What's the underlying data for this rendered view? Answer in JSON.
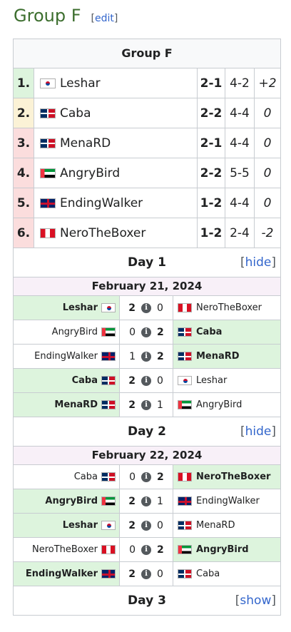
{
  "heading": {
    "title": "Group F",
    "edit_label": "edit"
  },
  "group_title": "Group F",
  "standings": [
    {
      "rank": "1.",
      "rank_color": "#ddf4dd",
      "flag": "kr",
      "name": "Leshar",
      "match_score": "2-1",
      "game_score": "4-2",
      "diff": "+2"
    },
    {
      "rank": "2.",
      "rank_color": "#fbf2d6",
      "flag": "do",
      "name": "Caba",
      "match_score": "2-2",
      "game_score": "4-4",
      "diff": "0"
    },
    {
      "rank": "3.",
      "rank_color": "#fbdddd",
      "flag": "do",
      "name": "MenaRD",
      "match_score": "2-1",
      "game_score": "4-4",
      "diff": "0"
    },
    {
      "rank": "4.",
      "rank_color": "#fbdddd",
      "flag": "ae",
      "name": "AngryBird",
      "match_score": "2-2",
      "game_score": "5-5",
      "diff": "0"
    },
    {
      "rank": "5.",
      "rank_color": "#fbdddd",
      "flag": "gb",
      "name": "EndingWalker",
      "match_score": "1-2",
      "game_score": "4-4",
      "diff": "0"
    },
    {
      "rank": "6.",
      "rank_color": "#fbdddd",
      "flag": "pe",
      "name": "NeroTheBoxer",
      "match_score": "1-2",
      "game_score": "2-4",
      "diff": "-2"
    }
  ],
  "days": [
    {
      "title": "Day 1",
      "toggle_label": "hide",
      "date": "February 21, 2024",
      "matches": [
        {
          "p1": "Leshar",
          "f1": "kr",
          "s1": "2",
          "s2": "0",
          "p2": "NeroTheBoxer",
          "f2": "pe",
          "winner": 1
        },
        {
          "p1": "AngryBird",
          "f1": "ae",
          "s1": "0",
          "s2": "2",
          "p2": "Caba",
          "f2": "do",
          "winner": 2
        },
        {
          "p1": "EndingWalker",
          "f1": "gb",
          "s1": "1",
          "s2": "2",
          "p2": "MenaRD",
          "f2": "do",
          "winner": 2
        },
        {
          "p1": "Caba",
          "f1": "do",
          "s1": "2",
          "s2": "0",
          "p2": "Leshar",
          "f2": "kr",
          "winner": 1
        },
        {
          "p1": "MenaRD",
          "f1": "do",
          "s1": "2",
          "s2": "1",
          "p2": "AngryBird",
          "f2": "ae",
          "winner": 1
        }
      ]
    },
    {
      "title": "Day 2",
      "toggle_label": "hide",
      "date": "February 22, 2024",
      "matches": [
        {
          "p1": "Caba",
          "f1": "do",
          "s1": "0",
          "s2": "2",
          "p2": "NeroTheBoxer",
          "f2": "pe",
          "winner": 2
        },
        {
          "p1": "AngryBird",
          "f1": "ae",
          "s1": "2",
          "s2": "1",
          "p2": "EndingWalker",
          "f2": "gb",
          "winner": 1
        },
        {
          "p1": "Leshar",
          "f1": "kr",
          "s1": "2",
          "s2": "0",
          "p2": "MenaRD",
          "f2": "do",
          "winner": 1
        },
        {
          "p1": "NeroTheBoxer",
          "f1": "pe",
          "s1": "0",
          "s2": "2",
          "p2": "AngryBird",
          "f2": "ae",
          "winner": 2
        },
        {
          "p1": "EndingWalker",
          "f1": "gb",
          "s1": "2",
          "s2": "0",
          "p2": "Caba",
          "f2": "do",
          "winner": 1
        }
      ]
    },
    {
      "title": "Day 3",
      "toggle_label": "show",
      "date": null,
      "matches": []
    }
  ],
  "info_icon": "info-icon"
}
